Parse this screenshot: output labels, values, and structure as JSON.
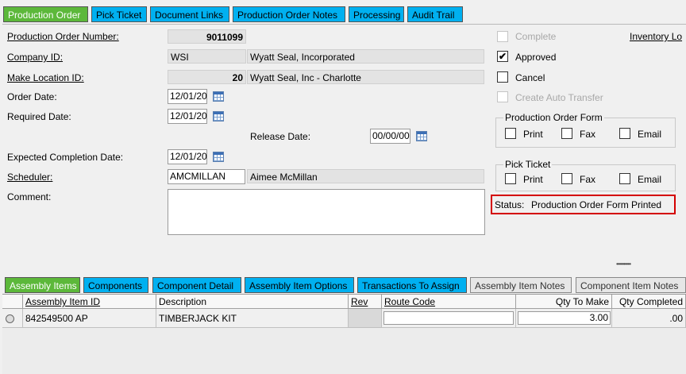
{
  "top_tabs": [
    "Production Order",
    "Pick Ticket",
    "Document Links",
    "Production Order Notes",
    "Processing",
    "Audit Trail"
  ],
  "header": {
    "production_order_number_label": "Production Order Number:",
    "production_order_number": "9011099",
    "company_id_label": "Company ID:",
    "company_id": "WSI",
    "company_name": "Wyatt Seal, Incorporated",
    "make_location_label": "Make Location ID:",
    "make_location_id": "20",
    "make_location_name": "Wyatt Seal, Inc - Charlotte",
    "order_date_label": "Order Date:",
    "order_date": "12/01/20",
    "required_date_label": "Required Date:",
    "required_date": "12/01/20",
    "release_date_label": "Release Date:",
    "release_date": "00/00/00",
    "expected_completion_label": "Expected Completion Date:",
    "expected_completion_date": "12/01/20",
    "scheduler_label": "Scheduler:",
    "scheduler_id": "AMCMILLAN",
    "scheduler_name": "Aimee McMillan",
    "comment_label": "Comment:",
    "comment": ""
  },
  "flags": {
    "complete_label": "Complete",
    "complete": false,
    "approved_label": "Approved",
    "approved": true,
    "approved_mark": "✔",
    "cancel_label": "Cancel",
    "cancel": false,
    "auto_transfer_label": "Create Auto Transfer",
    "auto_transfer": false,
    "inventory_link": "Inventory Lo"
  },
  "production_order_form": {
    "title": "Production Order Form",
    "print": "Print",
    "fax": "Fax",
    "email": "Email"
  },
  "pick_ticket": {
    "title": "Pick Ticket",
    "print": "Print",
    "fax": "Fax",
    "email": "Email"
  },
  "status": {
    "label": "Status:",
    "value": "Production Order Form Printed"
  },
  "splitter_dots": "••••••••••",
  "bottom_tabs": [
    "Assembly Items",
    "Components",
    "Component Detail",
    "Assembly Item Options",
    "Transactions To Assign",
    "Assembly Item Notes",
    "Component Item Notes"
  ],
  "grid": {
    "columns": [
      "Assembly Item ID",
      "Description",
      "Rev",
      "Route Code",
      "Qty To Make",
      "Qty Completed"
    ],
    "rows": [
      {
        "item_id": "842549500 AP",
        "description": "TIMBERJACK KIT",
        "rev": "",
        "route_code": "",
        "qty_to_make": "3.00",
        "qty_completed": ".00"
      }
    ]
  },
  "colors": {
    "active_tab": "#5cb83a",
    "inactive_tab": "#00b0f0",
    "status_border": "#d40000"
  }
}
